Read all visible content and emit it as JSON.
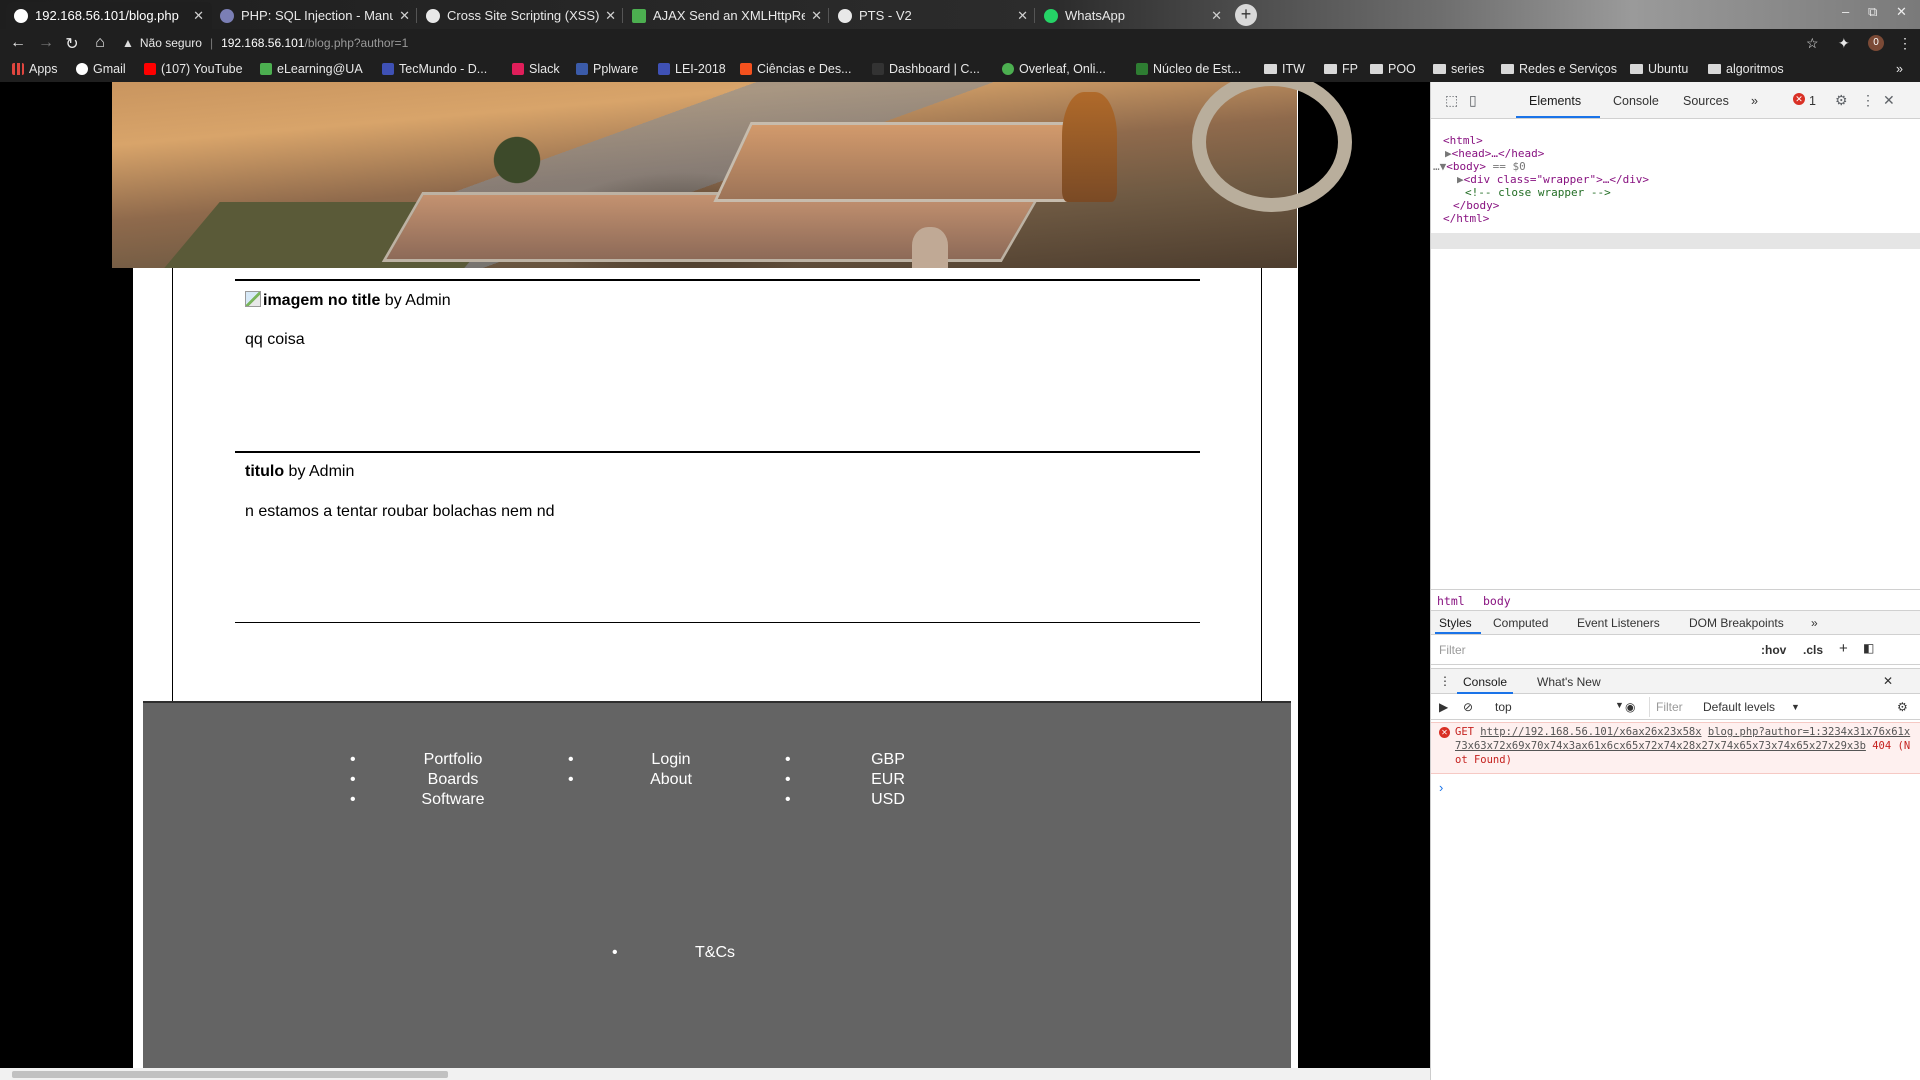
{
  "browser": {
    "tabs": [
      {
        "label": "192.168.56.101/blog.php",
        "active": true,
        "color": "#ffffff"
      },
      {
        "label": "PHP: SQL Injection - Manu",
        "active": false,
        "color": "#7b7fb5"
      },
      {
        "label": "Cross Site Scripting (XSS)",
        "active": false,
        "color": "#e8e8e8"
      },
      {
        "label": "AJAX Send an XMLHttpRe",
        "active": false,
        "color": "#4caf50"
      },
      {
        "label": "PTS - V2",
        "active": false,
        "color": "#e8e8e8"
      },
      {
        "label": "WhatsApp",
        "active": false,
        "color": "#25d366"
      }
    ],
    "new_tab_label": "+",
    "window_buttons": [
      "–",
      "⧉",
      "✕"
    ],
    "address": {
      "security_label": "Não seguro",
      "host": "192.168.56.101",
      "path": "/blog.php?author=1"
    },
    "avatar_letter": "0",
    "bookmarks": [
      {
        "label": "Apps",
        "type": "apps",
        "color": "#e0463f"
      },
      {
        "label": "Gmail",
        "type": "site",
        "color": "#ffffff"
      },
      {
        "label": "(107) YouTube",
        "type": "site",
        "color": "#ff0000"
      },
      {
        "label": "eLearning@UA",
        "type": "site",
        "color": "#4caf50"
      },
      {
        "label": "TecMundo - D...",
        "type": "site",
        "color": "#3f51b5"
      },
      {
        "label": "Slack",
        "type": "site",
        "color": "#e01e5a"
      },
      {
        "label": "Pplware",
        "type": "site",
        "color": "#3b5ba9"
      },
      {
        "label": "LEI-2018",
        "type": "site",
        "color": "#3f51b5"
      },
      {
        "label": "Ciências e Des...",
        "type": "site",
        "color": "#f4511e"
      },
      {
        "label": "Dashboard | C...",
        "type": "site",
        "color": "#333333"
      },
      {
        "label": "Overleaf, Onli...",
        "type": "site",
        "color": "#4caf50"
      },
      {
        "label": "Núcleo de Est...",
        "type": "site",
        "color": "#2e7d32"
      },
      {
        "label": "ITW",
        "type": "folder"
      },
      {
        "label": "FP",
        "type": "folder"
      },
      {
        "label": "POO",
        "type": "folder"
      },
      {
        "label": "series",
        "type": "folder"
      },
      {
        "label": "Redes e Serviços",
        "type": "folder"
      },
      {
        "label": "Ubuntu",
        "type": "folder"
      },
      {
        "label": "algoritmos",
        "type": "folder"
      }
    ],
    "bookmarks_overflow": "»"
  },
  "page": {
    "posts": [
      {
        "title": "imagem no title",
        "by": " by Admin",
        "body": "qq coisa",
        "broken_image": true
      },
      {
        "title": "titulo",
        "by": " by Admin",
        "body": "n estamos a tentar roubar bolachas nem nd",
        "broken_image": false
      }
    ],
    "footer": {
      "col1": [
        "Portfolio",
        "Boards",
        "Software"
      ],
      "col2": [
        "Login",
        "About"
      ],
      "col3": [
        "GBP",
        "EUR",
        "USD"
      ],
      "terms": "T&Cs"
    }
  },
  "devtools": {
    "tabs": [
      "Elements",
      "Console",
      "Sources",
      "»"
    ],
    "error_count": "1",
    "dom": {
      "html_open": "<html>",
      "head": "<head>…</head>",
      "body_open": "<body>",
      "body_selected_marker": "== $0",
      "wrapper_div": "<div class=\"wrapper\">…</div>",
      "comment": "<!-- close wrapper -->",
      "body_close": "</body>",
      "html_close": "</html>"
    },
    "breadcrumbs": [
      "html",
      "body"
    ],
    "styles_tabs": [
      "Styles",
      "Computed",
      "Event Listeners",
      "DOM Breakpoints",
      "»"
    ],
    "styles_filter_placeholder": "Filter",
    "styles_hov": ":hov",
    "styles_cls": ".cls",
    "drawer_tabs": [
      "Console",
      "What's New"
    ],
    "console": {
      "context": "top",
      "filter_placeholder": "Filter",
      "levels": "Default levels",
      "error": {
        "method": "GET",
        "url": "http://192.168.56.101/x6ax26x23x58x",
        "source": "blog.php?author=1:32",
        "url_rest": "34x31x76x61x73x63x72x69x70x74x3ax61x6cx65x72x74x28x27x74x65x73x74x65x27x29x3b",
        "status": "404 (Not Found)"
      },
      "prompt": "›"
    }
  }
}
